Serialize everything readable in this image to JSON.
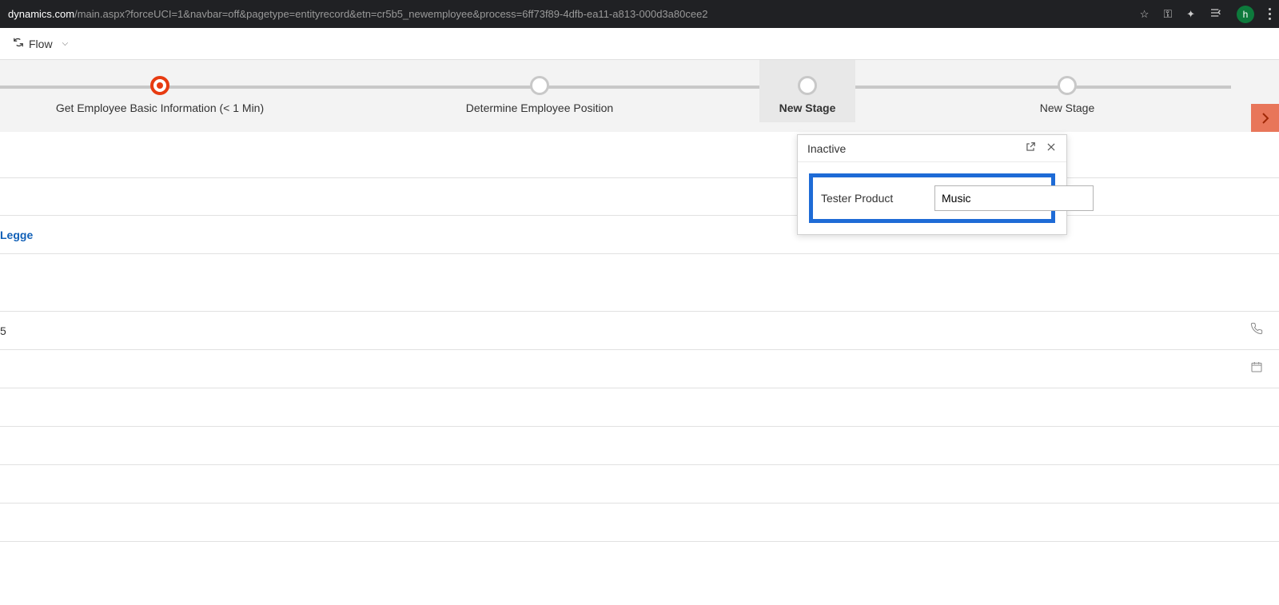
{
  "browser": {
    "url_domain": "dynamics.com",
    "url_path": "/main.aspx?forceUCI=1&navbar=off&pagetype=entityrecord&etn=cr5b5_newemployee&process=6ff73f89-4dfb-ea11-a813-000d3a80cee2",
    "avatar_letter": "h"
  },
  "toolbar": {
    "flow_label": "Flow"
  },
  "process": {
    "stages": [
      {
        "label": "Get Employee Basic Information  (< 1 Min)"
      },
      {
        "label": "Determine Employee Position"
      },
      {
        "label": "New Stage"
      },
      {
        "label": "New Stage"
      }
    ]
  },
  "popup": {
    "title": "Inactive",
    "field_label": "Tester Product",
    "field_value": "Music"
  },
  "rows": {
    "owner": "Legge",
    "phone_value": "5"
  }
}
